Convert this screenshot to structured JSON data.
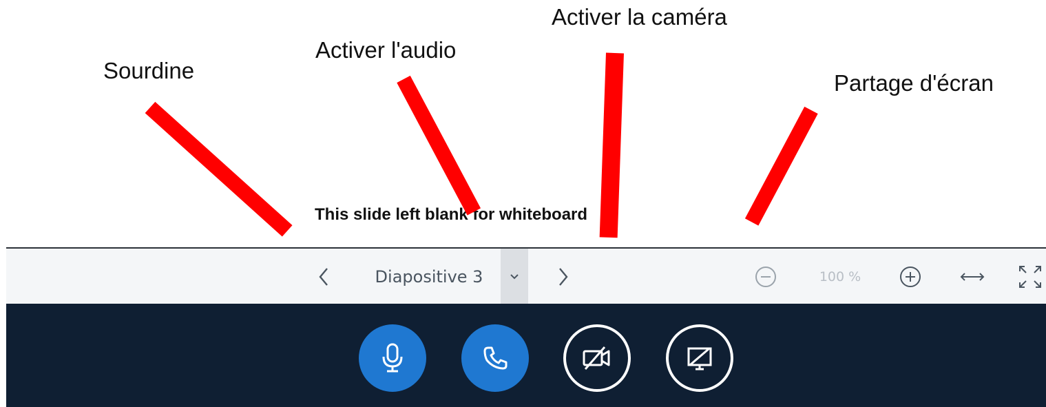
{
  "annotations": {
    "mute": "Sourdine",
    "audio": "Activer l'audio",
    "camera": "Activer la caméra",
    "screen_share": "Partage d'écran"
  },
  "slide": {
    "text": "This slide left blank for whiteboard"
  },
  "presentation_toolbar": {
    "prev_icon": "chevron-left-icon",
    "slide_label": "Diapositive 3",
    "dropdown_icon": "chevron-down-icon",
    "next_icon": "chevron-right-icon",
    "zoom_out_icon": "zoom-out-icon",
    "zoom_level": "100 %",
    "zoom_in_icon": "zoom-in-icon",
    "fit_width_icon": "fit-width-icon",
    "fullscreen_icon": "fullscreen-icon"
  },
  "action_bar": {
    "mute_icon": "microphone-icon",
    "audio_icon": "phone-icon",
    "camera_icon": "video-off-icon",
    "share_icon": "screen-share-off-icon"
  },
  "colors": {
    "arrow": "#ff0000",
    "action_bar_bg": "#0f1f33",
    "button_blue": "#1f78d1",
    "toolbar_bg": "#f4f6f8"
  }
}
